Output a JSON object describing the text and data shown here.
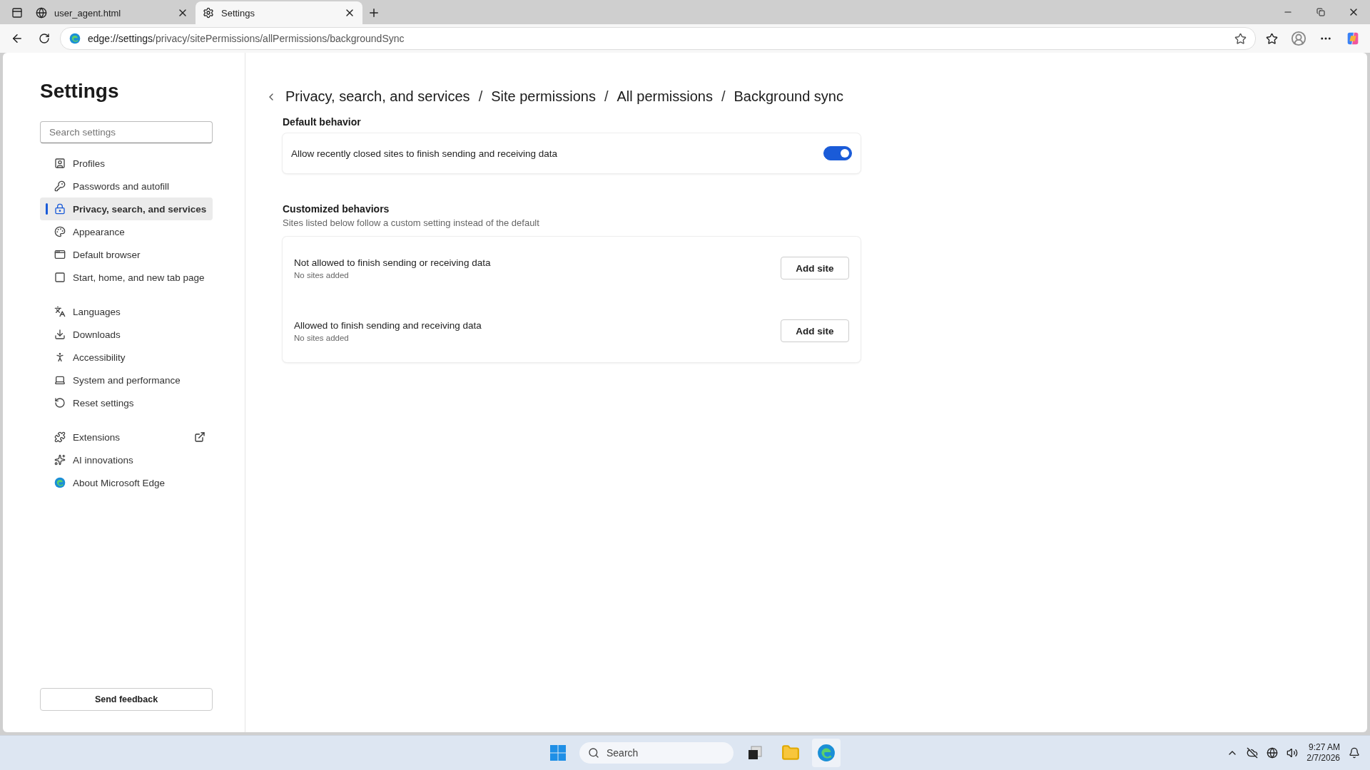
{
  "browser": {
    "tabs": [
      {
        "title": "user_agent.html",
        "selected": false
      },
      {
        "title": "Settings",
        "selected": true
      }
    ],
    "address": {
      "host": "edge://settings",
      "path": "/privacy/sitePermissions/allPermissions/backgroundSync"
    }
  },
  "sidebar": {
    "title": "Settings",
    "search": {
      "placeholder": "Search settings"
    },
    "groups": [
      [
        {
          "label": "Profiles",
          "selected": false,
          "external": false
        },
        {
          "label": "Passwords and autofill",
          "selected": false,
          "external": false
        },
        {
          "label": "Privacy, search, and services",
          "selected": true,
          "external": false
        },
        {
          "label": "Appearance",
          "selected": false,
          "external": false
        },
        {
          "label": "Default browser",
          "selected": false,
          "external": false
        },
        {
          "label": "Start, home, and new tab page",
          "selected": false,
          "external": false
        }
      ],
      [
        {
          "label": "Languages",
          "selected": false,
          "external": false
        },
        {
          "label": "Downloads",
          "selected": false,
          "external": false
        },
        {
          "label": "Accessibility",
          "selected": false,
          "external": false
        },
        {
          "label": "System and performance",
          "selected": false,
          "external": false
        },
        {
          "label": "Reset settings",
          "selected": false,
          "external": false
        }
      ],
      [
        {
          "label": "Extensions",
          "selected": false,
          "external": true
        },
        {
          "label": "AI innovations",
          "selected": false,
          "external": false
        },
        {
          "label": "About Microsoft Edge",
          "selected": false,
          "external": false
        }
      ]
    ],
    "feedback_button": "Send feedback"
  },
  "main": {
    "breadcrumb_separator": "/",
    "breadcrumb": [
      "Privacy, search, and services",
      "Site permissions",
      "All permissions",
      "Background sync"
    ],
    "default_behavior": {
      "heading": "Default behavior",
      "label": "Allow recently closed sites to finish sending and receiving data",
      "on": true
    },
    "customized": {
      "heading": "Customized behaviors",
      "description": "Sites listed below follow a custom setting instead of the default",
      "rows": [
        {
          "title": "Not allowed to finish sending or receiving data",
          "subtitle": "No sites added",
          "button": "Add site"
        },
        {
          "title": "Allowed to finish sending and receiving data",
          "subtitle": "No sites added",
          "button": "Add site"
        }
      ]
    }
  },
  "taskbar": {
    "search": {
      "placeholder": "Search"
    },
    "time": "9:27 AM",
    "date": "2/7/2026"
  }
}
